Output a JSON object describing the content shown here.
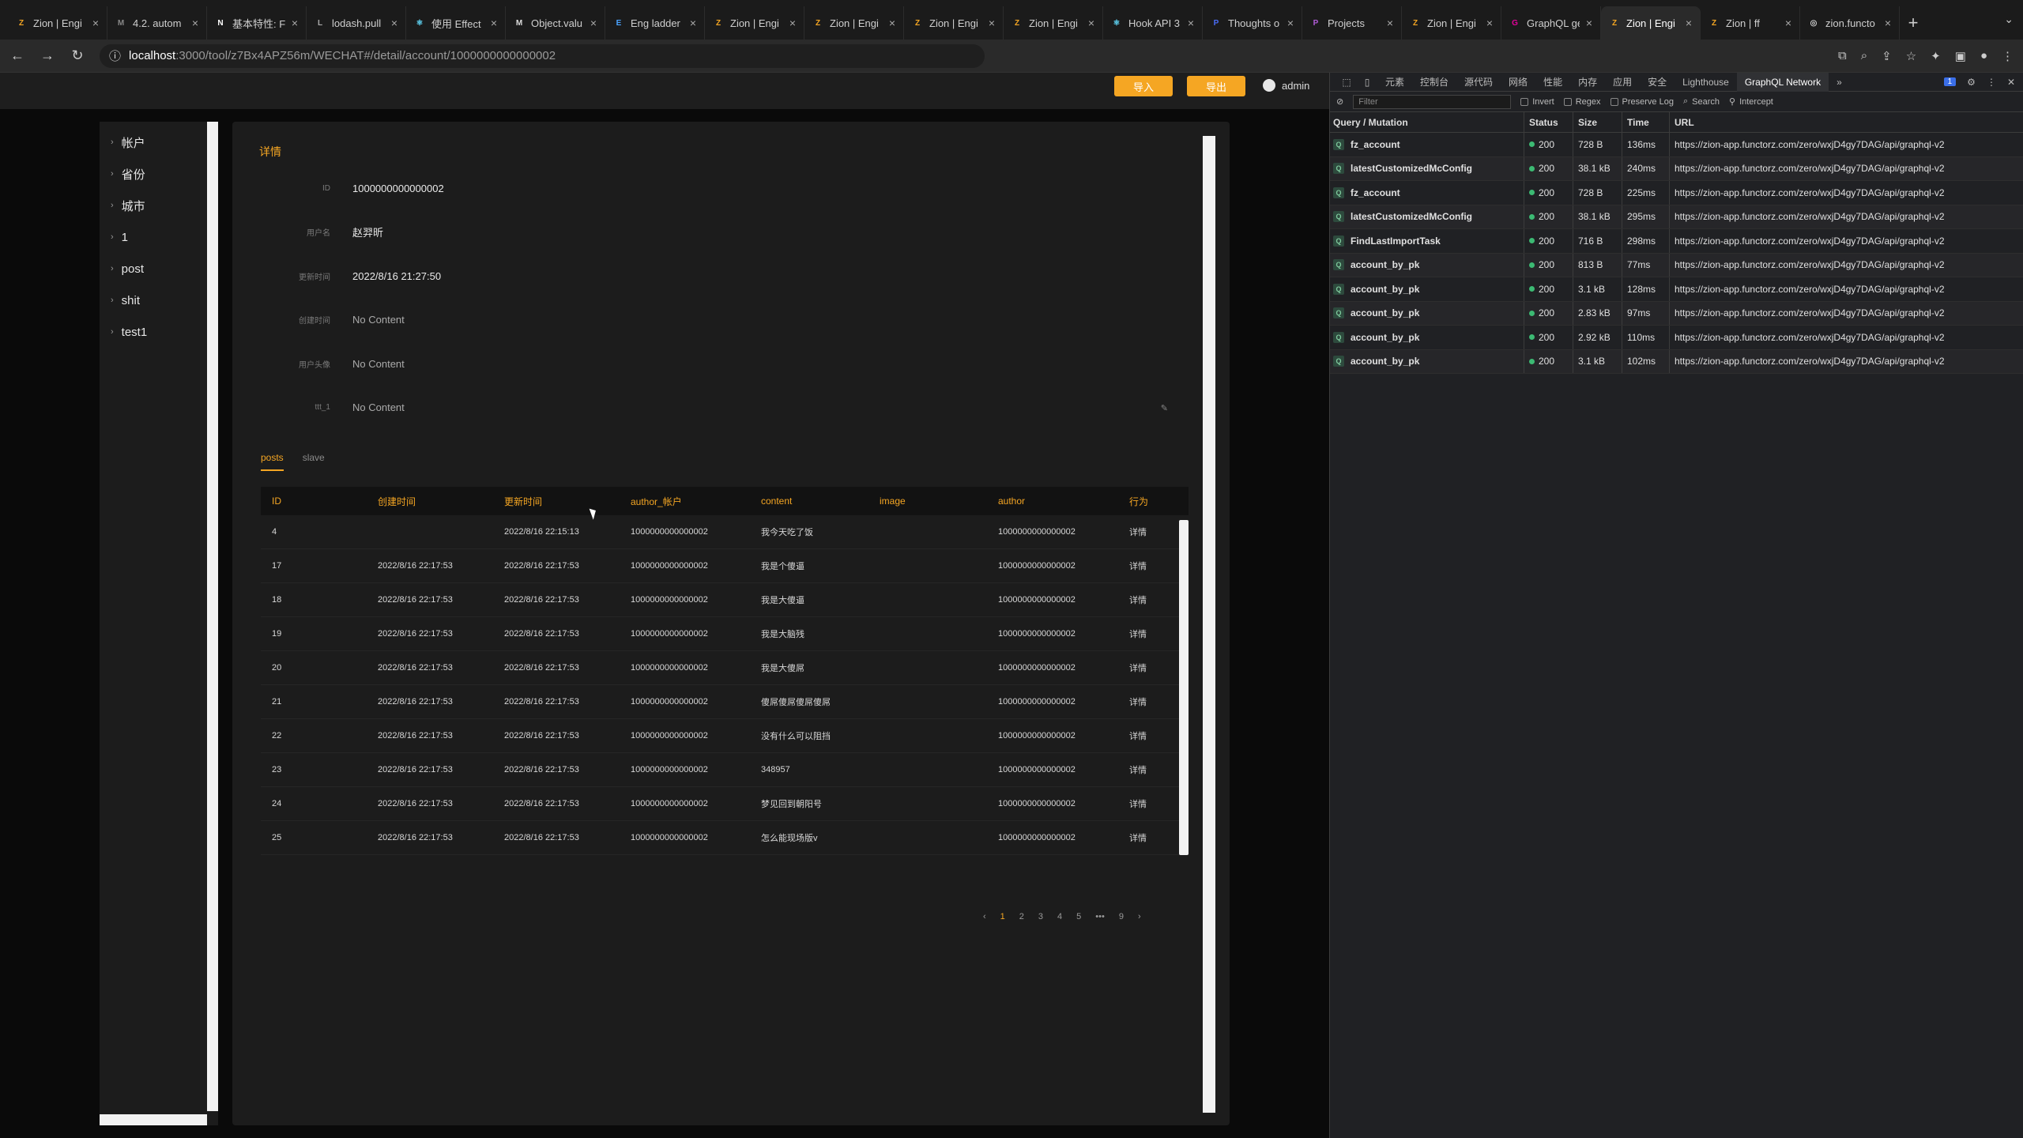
{
  "browser": {
    "tabs": [
      {
        "title": "Zion | Engi",
        "icon": "Z",
        "color": "#f5a623"
      },
      {
        "title": "4.2. autom",
        "icon": "M",
        "color": "#888888"
      },
      {
        "title": "基本特性: F",
        "icon": "N",
        "color": "#ffffff"
      },
      {
        "title": "lodash.pull",
        "icon": "L",
        "color": "#aaaaaa"
      },
      {
        "title": "使用 Effect",
        "icon": "⚛",
        "color": "#61dafb"
      },
      {
        "title": "Object.valu",
        "icon": "M",
        "color": "#dddddd"
      },
      {
        "title": "Eng ladder",
        "icon": "E",
        "color": "#4aa3ff"
      },
      {
        "title": "Zion | Engi",
        "icon": "Z",
        "color": "#f5a623"
      },
      {
        "title": "Zion | Engi",
        "icon": "Z",
        "color": "#f5a623"
      },
      {
        "title": "Zion | Engi",
        "icon": "Z",
        "color": "#f5a623"
      },
      {
        "title": "Zion | Engi",
        "icon": "Z",
        "color": "#f5a623"
      },
      {
        "title": "Hook API 3",
        "icon": "⚛",
        "color": "#61dafb"
      },
      {
        "title": "Thoughts o",
        "icon": "P",
        "color": "#4a6cf7"
      },
      {
        "title": "Projects",
        "icon": "P",
        "color": "#b05bd6"
      },
      {
        "title": "Zion | Engi",
        "icon": "Z",
        "color": "#f5a623"
      },
      {
        "title": "GraphQL ge",
        "icon": "G",
        "color": "#e10098"
      },
      {
        "title": "Zion | Engi",
        "icon": "Z",
        "color": "#f5a623"
      },
      {
        "title": "Zion | ff",
        "icon": "Z",
        "color": "#f5a623"
      },
      {
        "title": "zion.functo",
        "icon": "◎",
        "color": "#cccccc"
      }
    ],
    "active_tab_index": 16,
    "url_host": "localhost",
    "url_path": ":3000/tool/z7Bx4APZ56m/WECHAT#/detail/account/1000000000000002"
  },
  "header": {
    "import_label": "导入",
    "export_label": "导出",
    "user": "admin"
  },
  "sidebar": {
    "items": [
      "帐户",
      "省份",
      "城市",
      "1",
      "post",
      "shit",
      "test1"
    ]
  },
  "detail": {
    "title": "详情",
    "fields": [
      {
        "label": "ID",
        "value": "1000000000000002"
      },
      {
        "label": "用户名",
        "value": "赵羿昕"
      },
      {
        "label": "更新时间",
        "value": "2022/8/16 21:27:50"
      },
      {
        "label": "创建时间",
        "value": "No Content"
      },
      {
        "label": "用户头像",
        "value": "No Content"
      },
      {
        "label": "ttt_1",
        "value": "No Content"
      }
    ]
  },
  "subtabs": [
    "posts",
    "slave"
  ],
  "table": {
    "headers": [
      "ID",
      "创建时间",
      "更新时间",
      "author_帐户",
      "content",
      "image",
      "author",
      "行为"
    ],
    "rows": [
      [
        "4",
        "",
        "2022/8/16 22:15:13",
        "1000000000000002",
        "我今天吃了饭",
        "",
        "1000000000000002",
        "详情"
      ],
      [
        "17",
        "2022/8/16 22:17:53",
        "2022/8/16 22:17:53",
        "1000000000000002",
        "我是个傻逼",
        "",
        "1000000000000002",
        "详情"
      ],
      [
        "18",
        "2022/8/16 22:17:53",
        "2022/8/16 22:17:53",
        "1000000000000002",
        "我是大傻逼",
        "",
        "1000000000000002",
        "详情"
      ],
      [
        "19",
        "2022/8/16 22:17:53",
        "2022/8/16 22:17:53",
        "1000000000000002",
        "我是大脑残",
        "",
        "1000000000000002",
        "详情"
      ],
      [
        "20",
        "2022/8/16 22:17:53",
        "2022/8/16 22:17:53",
        "1000000000000002",
        "我是大傻屌",
        "",
        "1000000000000002",
        "详情"
      ],
      [
        "21",
        "2022/8/16 22:17:53",
        "2022/8/16 22:17:53",
        "1000000000000002",
        "傻屌傻屌傻屌傻屌",
        "",
        "1000000000000002",
        "详情"
      ],
      [
        "22",
        "2022/8/16 22:17:53",
        "2022/8/16 22:17:53",
        "1000000000000002",
        "没有什么可以阻挡",
        "",
        "1000000000000002",
        "详情"
      ],
      [
        "23",
        "2022/8/16 22:17:53",
        "2022/8/16 22:17:53",
        "1000000000000002",
        "348957",
        "",
        "1000000000000002",
        "详情"
      ],
      [
        "24",
        "2022/8/16 22:17:53",
        "2022/8/16 22:17:53",
        "1000000000000002",
        "梦见回到朝阳号",
        "",
        "1000000000000002",
        "详情"
      ],
      [
        "25",
        "2022/8/16 22:17:53",
        "2022/8/16 22:17:53",
        "1000000000000002",
        "怎么能现场版v",
        "",
        "1000000000000002",
        "详情"
      ]
    ]
  },
  "pagination": {
    "prev": "‹",
    "pages": [
      "1",
      "2",
      "3",
      "4",
      "5",
      "•••",
      "9"
    ],
    "current": "1",
    "next": "›"
  },
  "devtools": {
    "tabs": [
      "元素",
      "控制台",
      "源代码",
      "网络",
      "性能",
      "内存",
      "应用",
      "安全",
      "Lighthouse",
      "GraphQL Network"
    ],
    "active_tab": "GraphQL Network",
    "badge": "1",
    "filter_placeholder": "Filter",
    "options": [
      "Invert",
      "Regex",
      "Preserve Log",
      "Search",
      "Intercept"
    ],
    "columns": [
      "Query / Mutation",
      "Status",
      "Size",
      "Time",
      "URL"
    ],
    "rows": [
      {
        "name": "fz_account",
        "status": "200",
        "size": "728 B",
        "time": "136ms",
        "url": "https://zion-app.functorz.com/zero/wxjD4gy7DAG/api/graphql-v2"
      },
      {
        "name": "latestCustomizedMcConfig",
        "status": "200",
        "size": "38.1 kB",
        "time": "240ms",
        "url": "https://zion-app.functorz.com/zero/wxjD4gy7DAG/api/graphql-v2"
      },
      {
        "name": "fz_account",
        "status": "200",
        "size": "728 B",
        "time": "225ms",
        "url": "https://zion-app.functorz.com/zero/wxjD4gy7DAG/api/graphql-v2"
      },
      {
        "name": "latestCustomizedMcConfig",
        "status": "200",
        "size": "38.1 kB",
        "time": "295ms",
        "url": "https://zion-app.functorz.com/zero/wxjD4gy7DAG/api/graphql-v2"
      },
      {
        "name": "FindLastImportTask",
        "status": "200",
        "size": "716 B",
        "time": "298ms",
        "url": "https://zion-app.functorz.com/zero/wxjD4gy7DAG/api/graphql-v2"
      },
      {
        "name": "account_by_pk",
        "status": "200",
        "size": "813 B",
        "time": "77ms",
        "url": "https://zion-app.functorz.com/zero/wxjD4gy7DAG/api/graphql-v2"
      },
      {
        "name": "account_by_pk",
        "status": "200",
        "size": "3.1 kB",
        "time": "128ms",
        "url": "https://zion-app.functorz.com/zero/wxjD4gy7DAG/api/graphql-v2"
      },
      {
        "name": "account_by_pk",
        "status": "200",
        "size": "2.83 kB",
        "time": "97ms",
        "url": "https://zion-app.functorz.com/zero/wxjD4gy7DAG/api/graphql-v2"
      },
      {
        "name": "account_by_pk",
        "status": "200",
        "size": "2.92 kB",
        "time": "110ms",
        "url": "https://zion-app.functorz.com/zero/wxjD4gy7DAG/api/graphql-v2"
      },
      {
        "name": "account_by_pk",
        "status": "200",
        "size": "3.1 kB",
        "time": "102ms",
        "url": "https://zion-app.functorz.com/zero/wxjD4gy7DAG/api/graphql-v2"
      }
    ]
  }
}
